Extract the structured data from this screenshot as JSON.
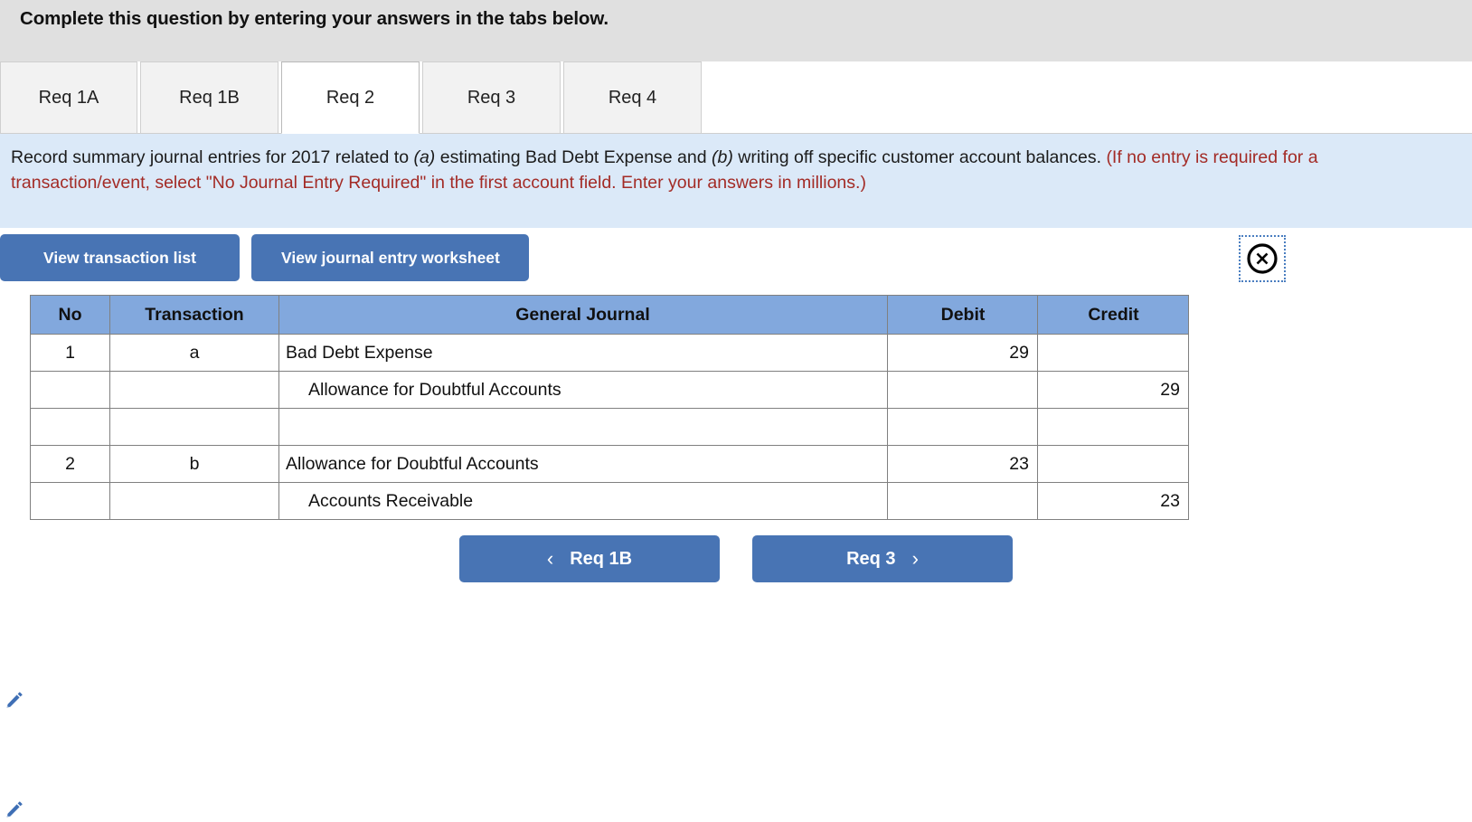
{
  "banner": {
    "text": "Complete this question by entering your answers in the tabs below."
  },
  "tabs": [
    {
      "label": "Req 1A",
      "active": false
    },
    {
      "label": "Req 1B",
      "active": false
    },
    {
      "label": "Req 2",
      "active": true
    },
    {
      "label": "Req 3",
      "active": false
    },
    {
      "label": "Req 4",
      "active": false
    }
  ],
  "instructions": {
    "part1": "Record summary journal entries for 2017 related to ",
    "italic_a": "(a)",
    "part2": " estimating Bad Debt Expense and ",
    "italic_b": "(b)",
    "part3": " writing off specific customer account balances. ",
    "red_note": "(If no entry is required for a transaction/event, select \"No Journal Entry Required\" in the first account field. Enter your answers in millions.)"
  },
  "toolbar": {
    "transaction_list_label": "View transaction list",
    "journal_worksheet_label": "View journal entry worksheet",
    "close_icon": "close-circle-icon"
  },
  "table": {
    "headers": [
      "No",
      "Transaction",
      "General Journal",
      "Debit",
      "Credit"
    ],
    "rows": [
      {
        "no": "1",
        "transaction": "a",
        "account": "Bad Debt Expense",
        "indent": false,
        "debit": "29",
        "credit": "",
        "edit_icon": true
      },
      {
        "no": "",
        "transaction": "",
        "account": "Allowance for Doubtful Accounts",
        "indent": true,
        "debit": "",
        "credit": "29",
        "edit_icon": false
      },
      {
        "no": "",
        "transaction": "",
        "account": "",
        "indent": false,
        "debit": "",
        "credit": "",
        "edit_icon": false
      },
      {
        "no": "2",
        "transaction": "b",
        "account": "Allowance for Doubtful Accounts",
        "indent": false,
        "debit": "23",
        "credit": "",
        "edit_icon": true
      },
      {
        "no": "",
        "transaction": "",
        "account": "Accounts Receivable",
        "indent": true,
        "debit": "",
        "credit": "23",
        "edit_icon": false
      }
    ]
  },
  "footer": {
    "prev_label": "Req 1B",
    "prev_chevron": "‹",
    "next_label": "Req 3",
    "next_chevron": "›"
  },
  "colors": {
    "accent_blue": "#4874b4",
    "table_header_blue": "#82a8dd",
    "instruction_bg": "#dbe9f8",
    "banner_bg": "#e0e0e0",
    "red_text": "#a32b26"
  }
}
